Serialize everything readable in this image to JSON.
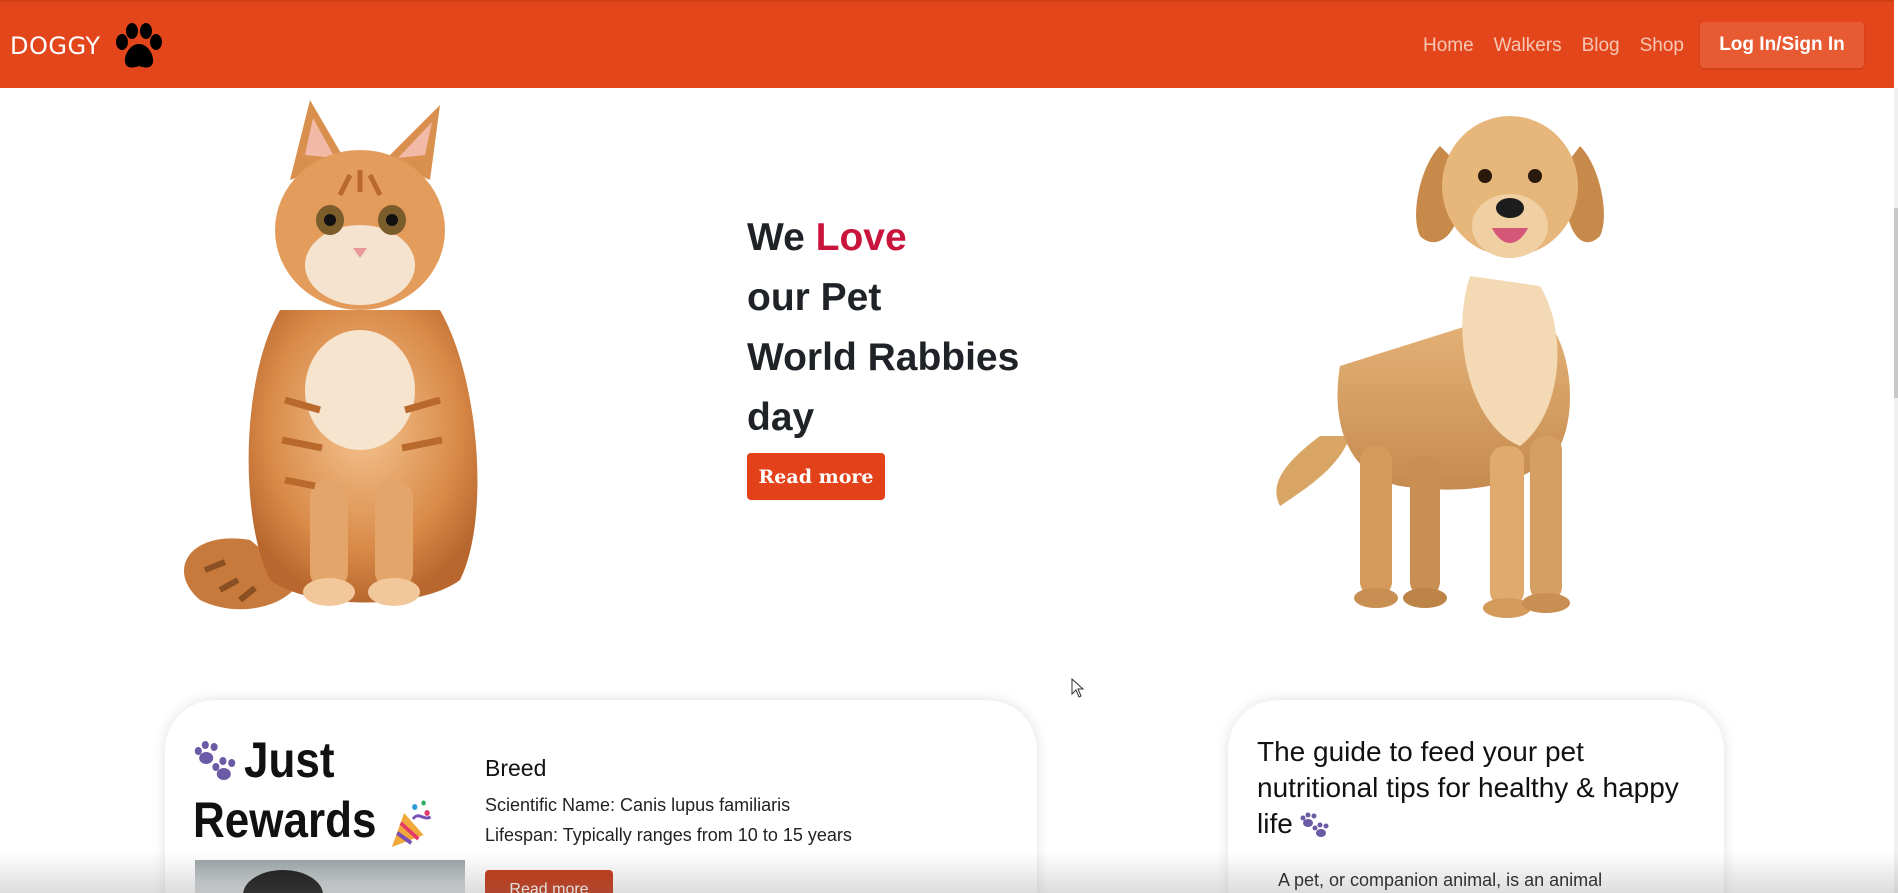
{
  "navbar": {
    "brand": "DOGGY",
    "logo_icon": "paw-icon",
    "links": [
      "Home",
      "Walkers",
      "Blog",
      "Shop"
    ],
    "login_label": "Log In/Sign In",
    "background_color": "#e4461b"
  },
  "hero": {
    "headline_part1": "We ",
    "headline_love": "Love",
    "headline_line2": "our Pet",
    "headline_line3": "World Rabbies",
    "headline_line4": "day",
    "read_more_label": "Read more",
    "accent_color": "#c9153c",
    "left_image": "orange-kitten-photo",
    "right_image": "golden-retriever-photo"
  },
  "rewards_card": {
    "title_line1": "Just",
    "title_line2": "Rewards",
    "icons": [
      "paws-icon",
      "party-popper-icon"
    ],
    "breed_title": "Breed",
    "scientific_name": "Scientific Name: Canis lupus familiaris",
    "lifespan": "Lifespan: Typically ranges from 10 to 15 years",
    "button_label": "Read more"
  },
  "guide_card": {
    "title": "The guide to feed your pet nutritional tips for healthy & happy life",
    "icon": "paws-icon",
    "text": "A pet, or companion animal, is an animal"
  }
}
